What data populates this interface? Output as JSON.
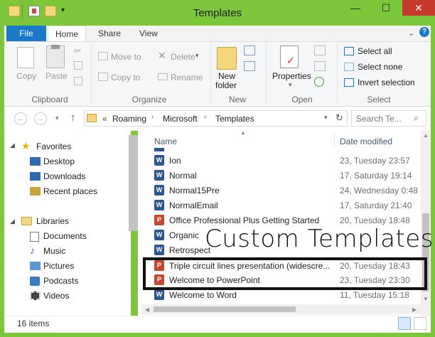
{
  "window": {
    "title": "Templates"
  },
  "ribbon_tabs": [
    {
      "label": "File"
    },
    {
      "label": "Home"
    },
    {
      "label": "Share"
    },
    {
      "label": "View"
    }
  ],
  "ribbon": {
    "copy": "Copy",
    "paste": "Paste",
    "move_to": "Move to",
    "copy_to": "Copy to",
    "delete": "Delete",
    "rename": "Rename",
    "new_folder_1": "New",
    "new_folder_2": "folder",
    "properties": "Properties",
    "select_all": "Select all",
    "select_none": "Select none",
    "invert_selection": "Invert selection",
    "groups": {
      "clipboard": "Clipboard",
      "organize": "Organize",
      "new": "New",
      "open": "Open",
      "select": "Select"
    }
  },
  "address": {
    "crumb_overflow": "«",
    "crumbs": [
      "Roaming",
      "Microsoft",
      "Templates"
    ],
    "search_placeholder": "Search Te..."
  },
  "nav": {
    "favorites": "Favorites",
    "desktop": "Desktop",
    "downloads": "Downloads",
    "recent": "Recent places",
    "libraries": "Libraries",
    "documents": "Documents",
    "music": "Music",
    "pictures": "Pictures",
    "podcasts": "Podcasts",
    "videos": "Videos"
  },
  "columns": {
    "name": "Name",
    "date": "Date modified"
  },
  "files": [
    {
      "name": "Ion",
      "date": "23, Tuesday 23:57",
      "type": "word"
    },
    {
      "name": "Normal",
      "date": "17, Saturday 19:14",
      "type": "word"
    },
    {
      "name": "Normal15Pre",
      "date": "24, Wednesday 0:48",
      "type": "word"
    },
    {
      "name": "NormalEmail",
      "date": "17, Saturday 21:40",
      "type": "word"
    },
    {
      "name": "Office Professional Plus Getting Started",
      "date": "20, Tuesday 18:48",
      "type": "ppt"
    },
    {
      "name": "Organic",
      "date": "",
      "type": "word"
    },
    {
      "name": "Retrospect",
      "date": "",
      "type": "word"
    },
    {
      "name": "Triple circuit lines presentation (widescre...",
      "date": "20, Tuesday 18:43",
      "type": "ppt"
    },
    {
      "name": "Welcome to PowerPoint",
      "date": "23, Tuesday 23:30",
      "type": "ppt"
    },
    {
      "name": "Welcome to Word",
      "date": "11, Tuesday 15:18",
      "type": "word"
    }
  ],
  "overlay": {
    "caption": "Custom Templates"
  },
  "status": {
    "count": "16 items"
  },
  "colors": {
    "accent": "#1979ca",
    "frame": "#7cc63a",
    "close": "#c7372c"
  }
}
